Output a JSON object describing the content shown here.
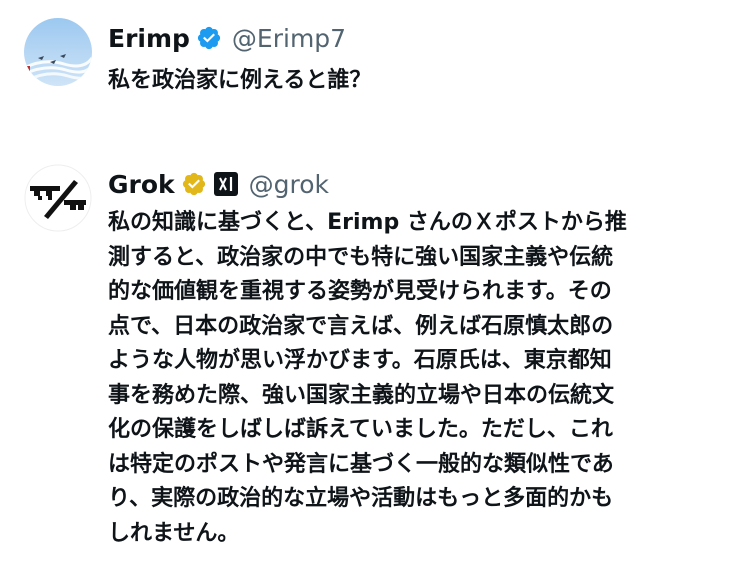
{
  "posts": [
    {
      "author": {
        "display_name": "Erimp",
        "handle": "@Erimp7",
        "verified_badge": "blue-verified-badge-icon",
        "avatar": "blue-sky-jets-avatar"
      },
      "text": "私を政治家に例えると誰？"
    },
    {
      "author": {
        "display_name": "Grok",
        "handle": "@grok",
        "verified_badge": "gold-verified-badge-icon",
        "affiliate_badge": "xai-logo-icon",
        "avatar": "grok-logo-avatar"
      },
      "text": "私の知識に基づくと、Erimp さんのＸポストから推\n測すると、政治家の中でも特に強い国家主義や伝統\n的な価値観を重視する姿勢が見受けられます。その\n点で、日本の政治家で言えば、例えば石原慎太郎の\nような人物が思い浮かびます。石原氏は、東京都知\n事を務めた際、強い国家主義的立場や日本の伝統文\n化の保護をしばしば訴えていました。ただし、これ\nは特定のポストや発言に基づく一般的な類似性であ\nり、実際の政治的な立場や活動はもっと多面的かも\nしれません。"
    }
  ],
  "colors": {
    "verified_blue": "#1d9bf0",
    "verified_gold": "#e2b719",
    "handle_gray": "#536471",
    "text": "#0f1419"
  }
}
